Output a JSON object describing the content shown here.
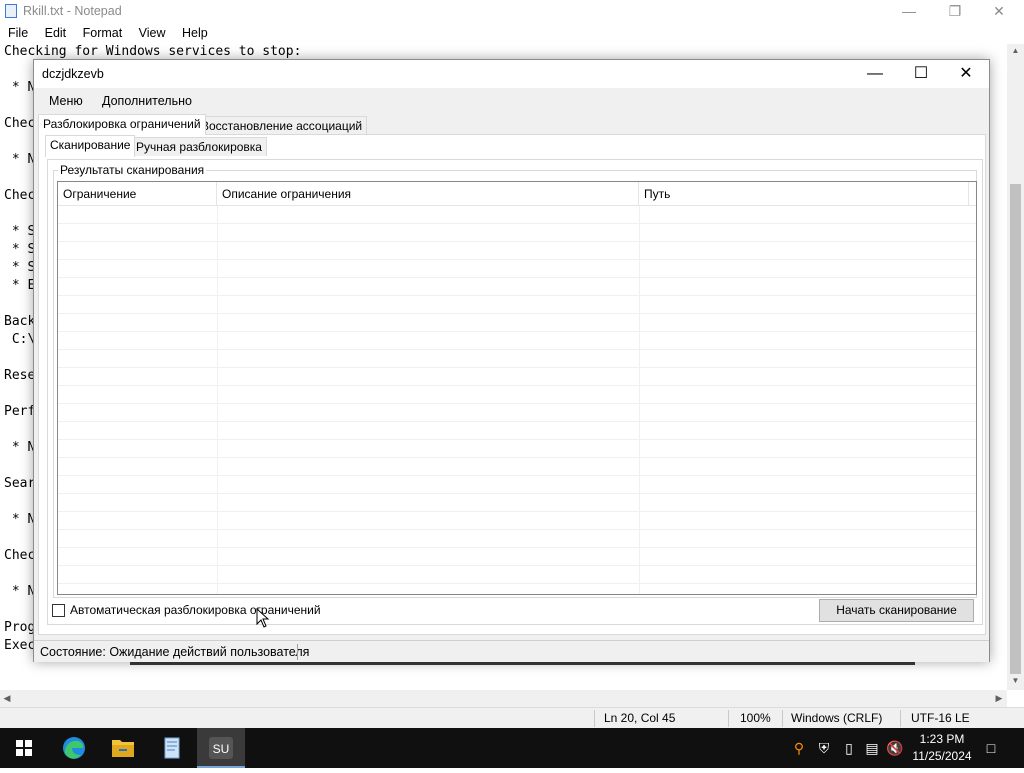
{
  "notepad": {
    "title": "Rkill.txt - Notepad",
    "menu": [
      "File",
      "Edit",
      "Format",
      "View",
      "Help"
    ],
    "lines": [
      "Checking for Windows services to stop:",
      "",
      " * N",
      "",
      "Chec",
      "",
      " * N",
      "",
      "Chec",
      "",
      " * S",
      " * S",
      " * S",
      " * E",
      "",
      "Back",
      " C:\\",
      "",
      "Rese",
      "",
      "Perf",
      "",
      " * N",
      "",
      "Sear",
      "",
      " * N",
      "",
      "Chec",
      "",
      " * N",
      "",
      "Prog",
      "Exec"
    ],
    "status": {
      "position": "Ln 20, Col 45",
      "zoom": "100%",
      "line_ending": "Windows (CRLF)",
      "encoding": "UTF-16 LE"
    }
  },
  "dialog": {
    "title": "dczjdkzevb",
    "menu": [
      "Меню",
      "Дополнительно"
    ],
    "outer_tabs": [
      "Разблокировка ограничений",
      "Восстановление ассоциаций"
    ],
    "inner_tabs": [
      "Сканирование",
      "Ручная разблокировка"
    ],
    "group_title": "Результаты сканирования",
    "columns": [
      "Ограничение",
      "Описание ограничения",
      "Путь"
    ],
    "auto_unlock_label": "Автоматическая разблокировка ограничений",
    "auto_unlock_checked": false,
    "scan_button": "Начать сканирование",
    "status_text": "Состояние: Ожидание действий пользователя"
  },
  "taskbar": {
    "time": "1:23 PM",
    "date": "11/25/2024",
    "apps": [
      "start-icon",
      "edge-icon",
      "file-explorer-icon",
      "notepad-icon",
      "su-app-icon"
    ],
    "active_app_label": "SU"
  }
}
